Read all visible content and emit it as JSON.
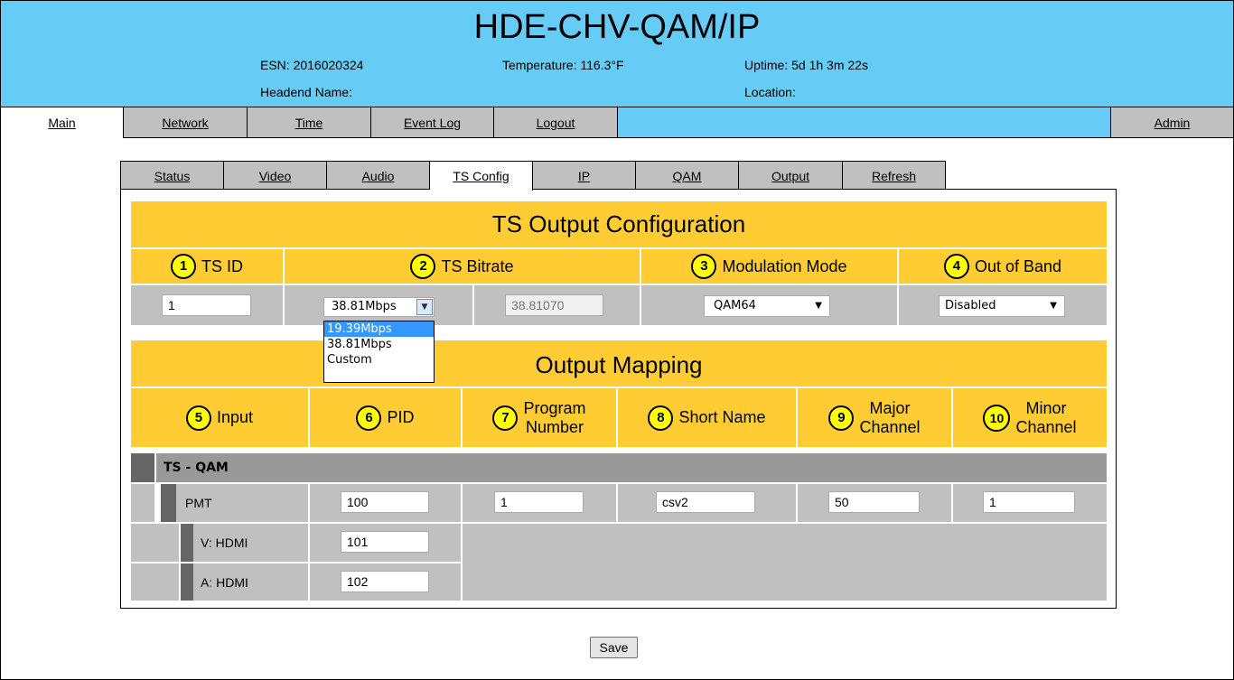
{
  "header": {
    "title": "HDE-CHV-QAM/IP",
    "esn": "ESN: 2016020324",
    "temperature": "Temperature: 116.3°F",
    "uptime": "Uptime: 5d 1h 3m 22s",
    "headend_name": "Headend Name:",
    "location": "Location:"
  },
  "main_nav": {
    "main": "Main",
    "network": "Network",
    "time": "Time",
    "event_log": "Event Log",
    "logout": "Logout",
    "admin": "Admin"
  },
  "sub_nav": {
    "status": "Status",
    "video": "Video",
    "audio": "Audio",
    "ts_config": "TS Config",
    "ip": "IP",
    "qam": "QAM",
    "output": "Output",
    "refresh": "Refresh"
  },
  "ts_output": {
    "title": "TS Output Configuration",
    "ts_id_label": "TS ID",
    "ts_bitrate_label": "TS Bitrate",
    "modulation_label": "Modulation Mode",
    "oob_label": "Out of Band",
    "ts_id_value": "1",
    "bitrate_selected": "38.81Mbps",
    "bitrate_custom_value": "38.81070",
    "modulation_selected": "QAM64",
    "oob_selected": "Disabled",
    "bitrate_options": [
      "19.39Mbps",
      "38.81Mbps",
      "Custom"
    ]
  },
  "mapping": {
    "title": "Output Mapping",
    "col_input": "Input",
    "col_pid": "PID",
    "col_program_line1": "Program",
    "col_program_line2": "Number",
    "col_short_name": "Short Name",
    "col_major_line1": "Major",
    "col_major_line2": "Channel",
    "col_minor_line1": "Minor",
    "col_minor_line2": "Channel",
    "group": "TS - QAM",
    "pmt_label": "PMT",
    "pmt_pid": "100",
    "pmt_program": "1",
    "pmt_short_name": "csv2",
    "pmt_major": "50",
    "pmt_minor": "1",
    "video_label": "V: HDMI",
    "video_pid": "101",
    "audio_label": "A: HDMI",
    "audio_pid": "102"
  },
  "badges": [
    "1",
    "2",
    "3",
    "4",
    "5",
    "6",
    "7",
    "8",
    "9",
    "10"
  ],
  "save_label": "Save",
  "colors": {
    "header_bg": "#66ccf5",
    "section_bg": "#ffcc33",
    "badge_bg": "#ffff00",
    "cell_bg": "#c0c0c0",
    "group_bg": "#999999",
    "highlight": "#3399ff"
  }
}
